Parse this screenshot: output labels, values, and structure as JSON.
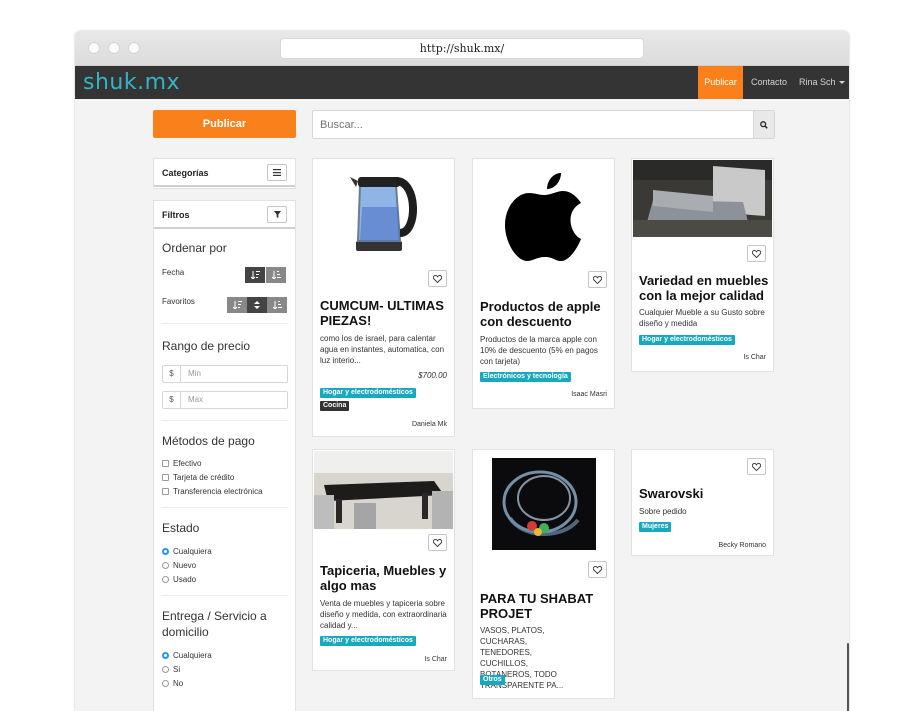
{
  "browser": {
    "url": "http://shuk.mx/"
  },
  "nav": {
    "logo": "shuk.mx",
    "publicar": "Publicar",
    "contacto": "Contacto",
    "user": "Rina Sch"
  },
  "toolbar": {
    "publicar": "Publicar",
    "search_placeholder": "Buscar..."
  },
  "sidebar": {
    "categorias": "Categorías",
    "filtros": "Filtros",
    "ordenar_por": "Ordenar por",
    "fecha": "Fecha",
    "favoritos": "Favoritos",
    "rango_precio": "Rango de precio",
    "currency": "$",
    "min": "Min",
    "max": "Max",
    "metodos_pago": "Métodos de pago",
    "pago_opts": [
      "Efectivo",
      "Tarjeta de crédito",
      "Transferencia electrónica"
    ],
    "estado": "Estado",
    "estado_opts": [
      "Cualquiera",
      "Nuevo",
      "Usado"
    ],
    "entrega": "Entrega / Servicio a domicilio",
    "entrega_opts": [
      "Cualquiera",
      "Si",
      "No"
    ]
  },
  "cards": [
    {
      "title": "CUMCUM- ULTIMAS PIEZAS!",
      "desc": "como los de israel, para calentar agua en instantes, automatica, con luz interio...",
      "price": "$700.00",
      "tags": [
        "Hogar y electrodomésticos",
        "Cocina"
      ],
      "user": "Daniela Mk"
    },
    {
      "title": "Productos de apple con descuento",
      "desc": "Productos de la marca apple con 10% de descuento (5% en pagos con tarjeta)",
      "tags": [
        "Electrónicos y tecnología"
      ],
      "user": "Isaac Masri"
    },
    {
      "title": "Variedad en muebles con la mejor calidad",
      "desc": "Cualquier Mueble a su Gusto sobre diseño y medida",
      "tags": [
        "Hogar y electrodomésticos"
      ],
      "user": "Is Char"
    },
    {
      "title": "Tapiceria, Muebles y algo mas",
      "desc": "Venta de muebles y tapiceria sobre diseño y medida, con extraordinaria calidad y...",
      "tags": [
        "Hogar y electrodomésticos"
      ],
      "user": "Is Char"
    },
    {
      "title": "PARA TU SHABAT PROJET",
      "desc": "VASOS, PLATOS, CUCHARAS, TENEDORES, CUCHILLOS, BOTANEROS, TODO TRANSPARENTE PA...",
      "tags": [
        "Otros"
      ],
      "user": ""
    },
    {
      "title": "Swarovski",
      "desc": "Sobre pedido",
      "tags": [
        "Mujeres"
      ],
      "user": "Becky Romano"
    }
  ],
  "colors": {
    "accent": "#f9801a",
    "brand": "#34b4c4",
    "tag": "#18a9bf",
    "nav": "#343434"
  }
}
